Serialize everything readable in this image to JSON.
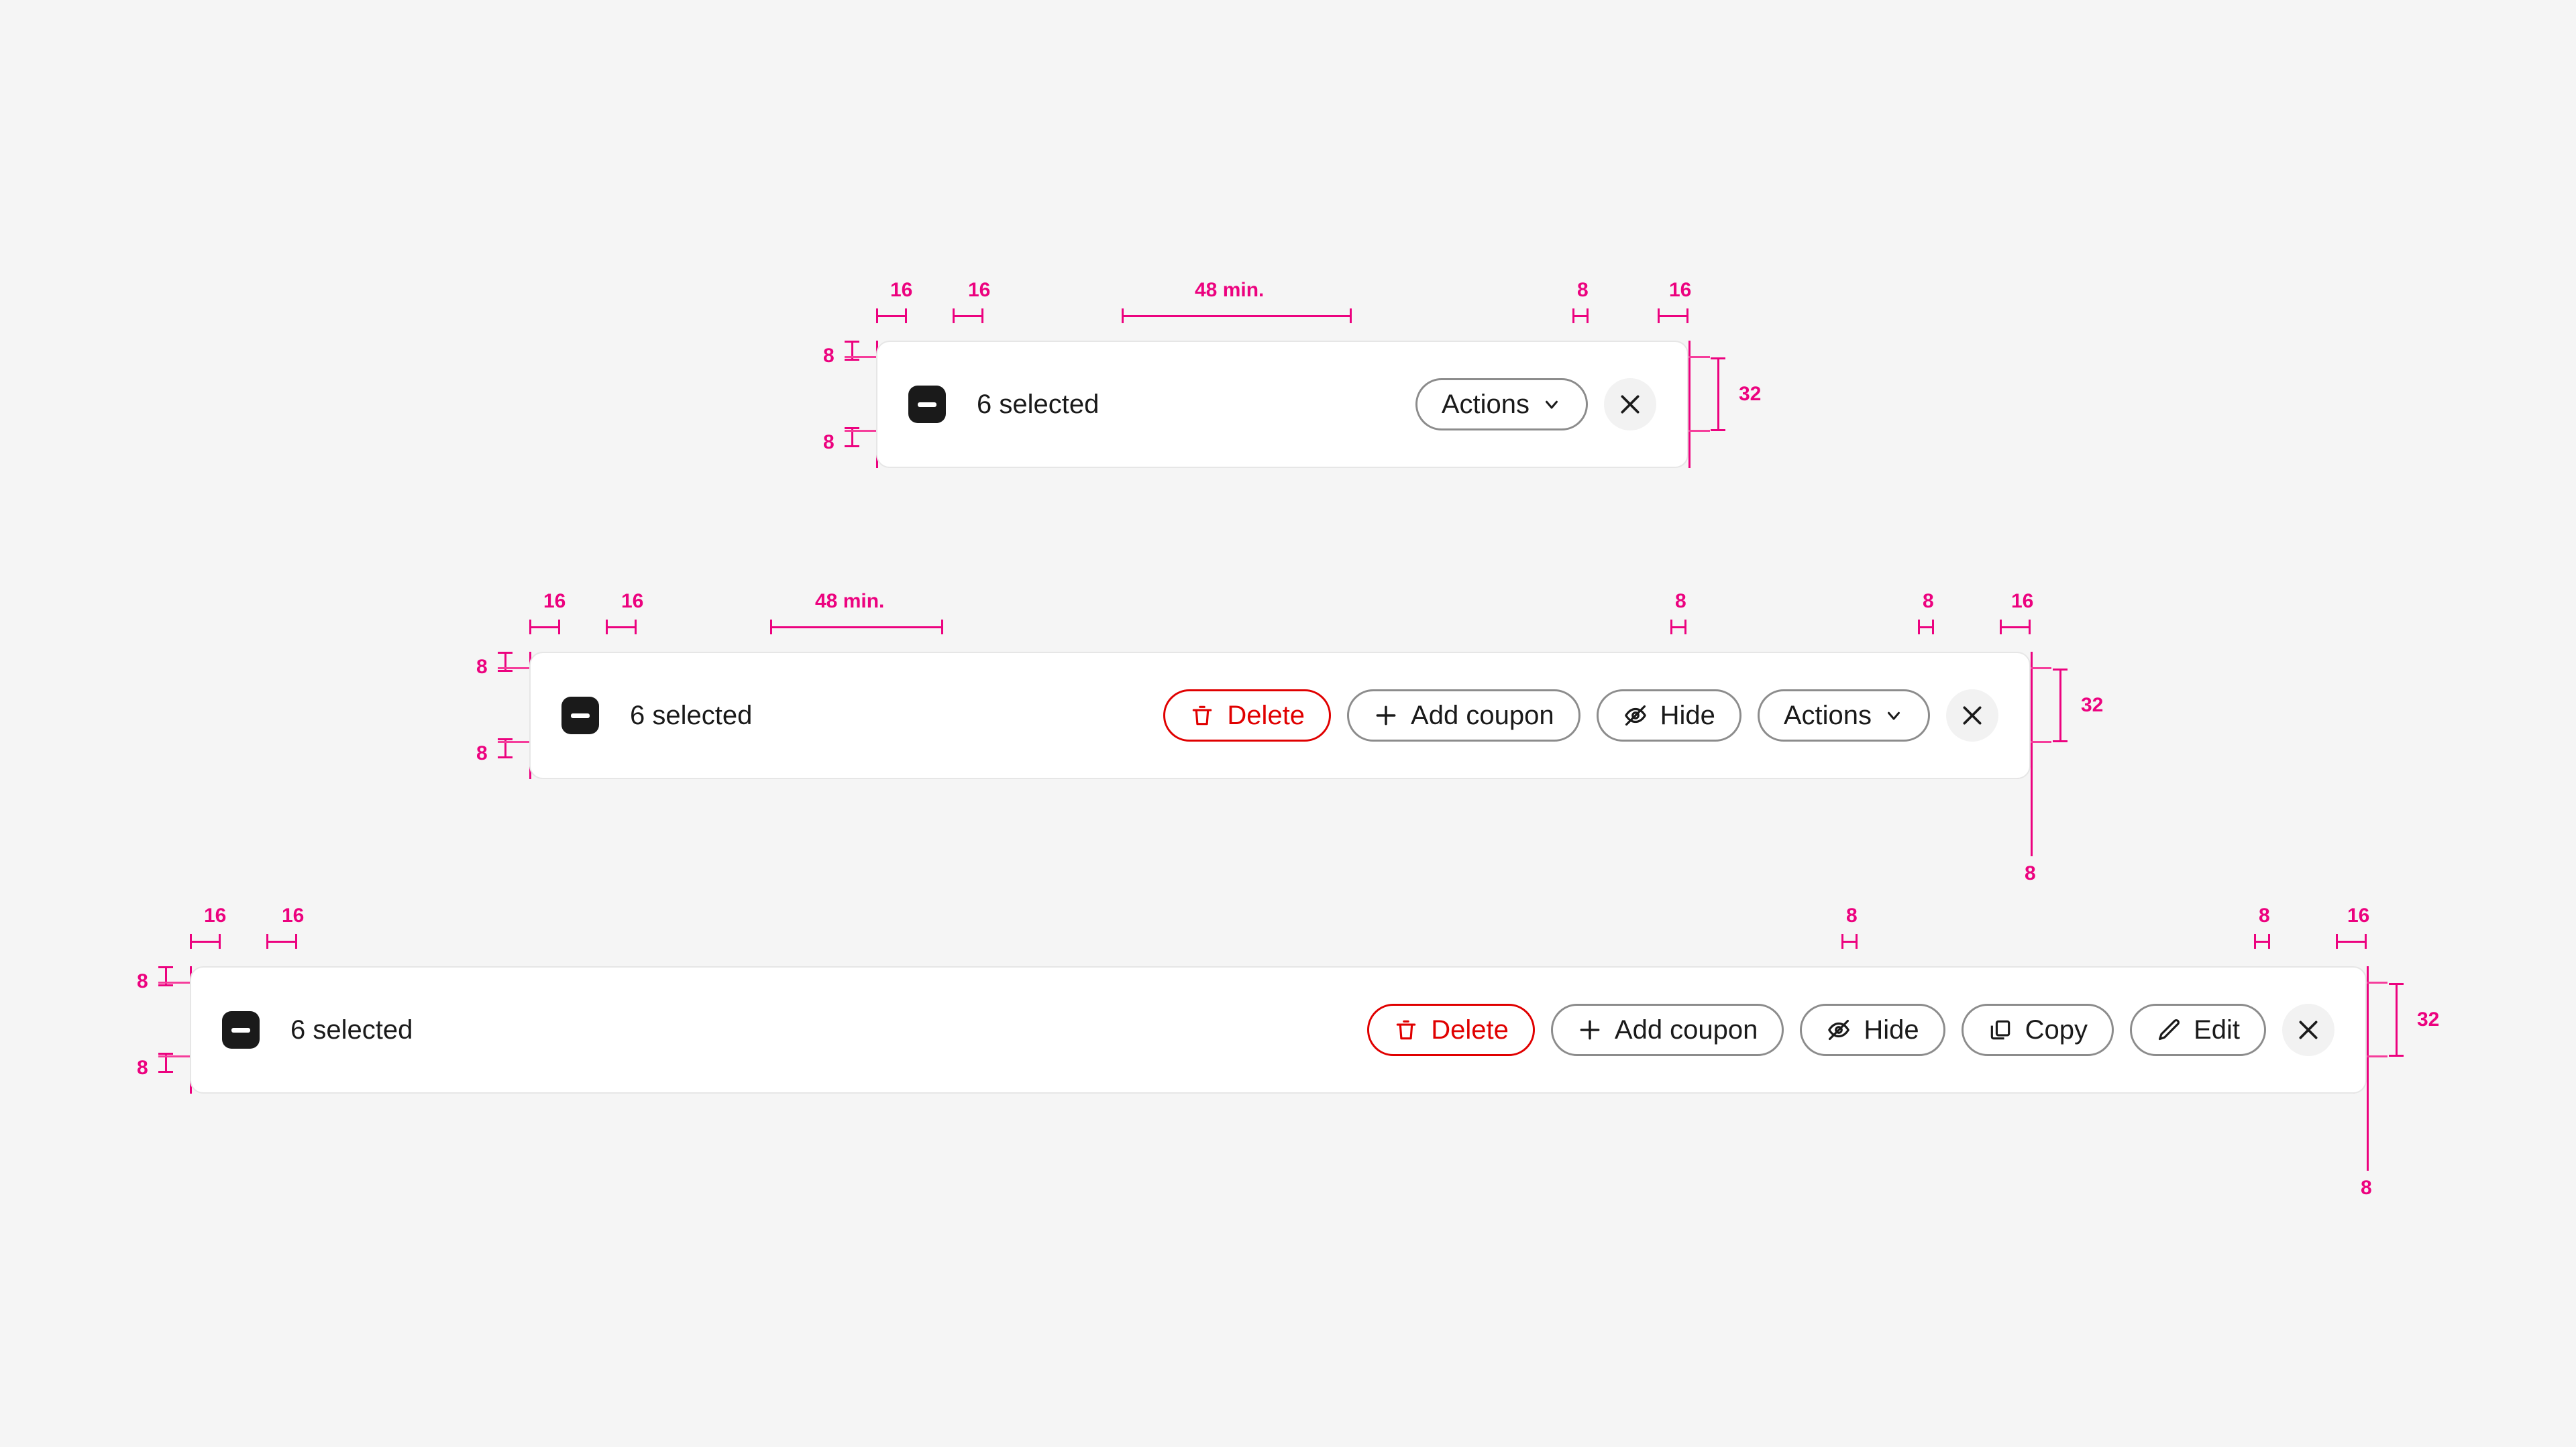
{
  "canvas": {
    "background": "#f5f5f5"
  },
  "accent": {
    "spec_pink": "#EC027F",
    "spec_pink_light": "#F53D9B",
    "danger_red": "#e00000",
    "checkbox_dark": "#1a1a1a"
  },
  "common": {
    "selected_label": "6 selected",
    "close_icon": "close-icon",
    "checkbox_icon": "checkbox-indeterminate-icon"
  },
  "specs": {
    "pad_16": "16",
    "pad_8": "8",
    "pad_min_48": "48 min.",
    "height_32": "32",
    "radius_8": "8",
    "vpad_8": "8"
  },
  "bars": [
    {
      "id": "bar-compact",
      "selected_label": "6 selected",
      "buttons": [
        {
          "name": "actions-button",
          "label": "Actions",
          "icon": "chevron-down-icon",
          "variant": "default"
        }
      ],
      "close_label": ""
    },
    {
      "id": "bar-medium",
      "selected_label": "6 selected",
      "buttons": [
        {
          "name": "delete-button",
          "label": "Delete",
          "icon": "trash-icon",
          "variant": "danger"
        },
        {
          "name": "add-coupon-button",
          "label": "Add coupon",
          "icon": "plus-icon",
          "variant": "default"
        },
        {
          "name": "hide-button",
          "label": "Hide",
          "icon": "eye-off-icon",
          "variant": "default"
        },
        {
          "name": "actions-button",
          "label": "Actions",
          "icon": "chevron-down-icon",
          "variant": "default"
        }
      ],
      "close_label": ""
    },
    {
      "id": "bar-wide",
      "selected_label": "6 selected",
      "buttons": [
        {
          "name": "delete-button",
          "label": "Delete",
          "icon": "trash-icon",
          "variant": "danger"
        },
        {
          "name": "add-coupon-button",
          "label": "Add coupon",
          "icon": "plus-icon",
          "variant": "default"
        },
        {
          "name": "hide-button",
          "label": "Hide",
          "icon": "eye-off-icon",
          "variant": "default"
        },
        {
          "name": "copy-button",
          "label": "Copy",
          "icon": "copy-icon",
          "variant": "default"
        },
        {
          "name": "edit-button",
          "label": "Edit",
          "icon": "pencil-icon",
          "variant": "default"
        }
      ],
      "close_label": ""
    }
  ]
}
